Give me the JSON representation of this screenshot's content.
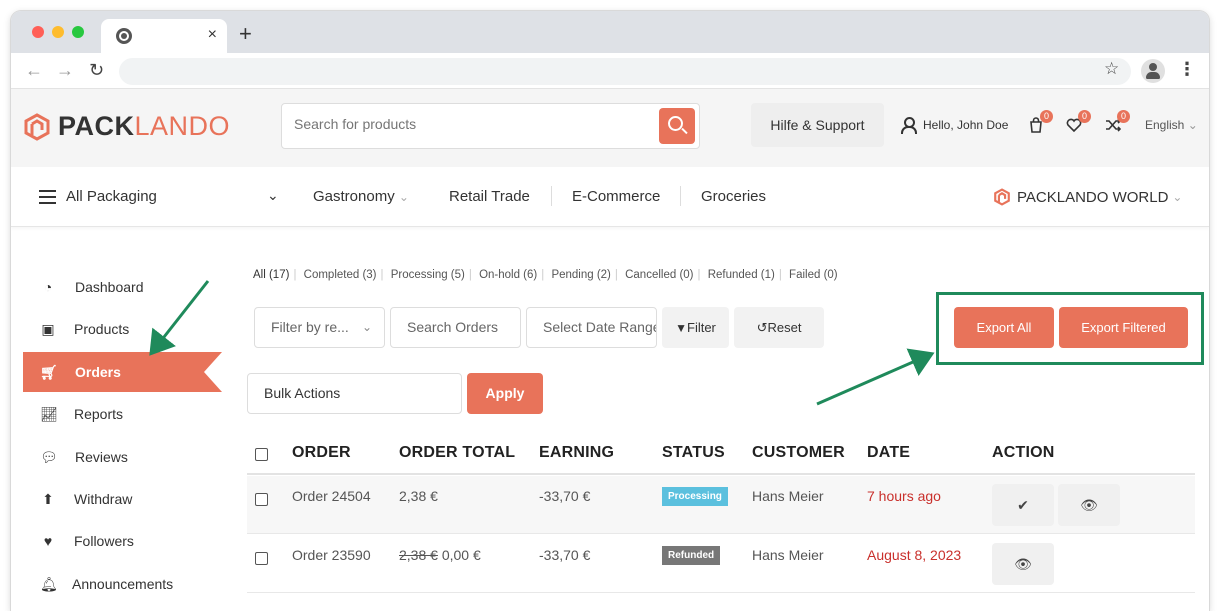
{
  "browser": {
    "tab_close": "×",
    "new_tab": "+",
    "back": "←",
    "forward": "→",
    "reload": "↻",
    "star": "☆",
    "menu": "⋮"
  },
  "header": {
    "logo_pack": "PACK",
    "logo_lando": "LANDO",
    "search_placeholder": "Search for products",
    "support_label": "Hilfe & Support",
    "hello_label": "Hello, John Doe",
    "cart_count": "0",
    "wishlist_count": "0",
    "compare_count": "0",
    "language": "English",
    "language_chevron": "⌄"
  },
  "catnav": {
    "all_label": "All Packaging",
    "chevron": "⌄",
    "items": [
      {
        "label": "Gastronomy",
        "chevron": "⌄"
      },
      {
        "label": "Retail Trade"
      },
      {
        "label": "E-Commerce"
      },
      {
        "label": "Groceries"
      }
    ],
    "world_label": "PACKLANDO WORLD",
    "world_chevron": "⌄"
  },
  "sidebar": {
    "items": [
      {
        "label": "Dashboard",
        "icon": "gauge-icon"
      },
      {
        "label": "Products",
        "icon": "briefcase-icon"
      },
      {
        "label": "Orders",
        "icon": "cart-icon",
        "active": true
      },
      {
        "label": "Reports",
        "icon": "chart-icon"
      },
      {
        "label": "Reviews",
        "icon": "comments-icon"
      },
      {
        "label": "Withdraw",
        "icon": "upload-icon"
      },
      {
        "label": "Followers",
        "icon": "heart-icon"
      },
      {
        "label": "Announcements",
        "icon": "bell-icon"
      }
    ]
  },
  "filters": {
    "statuses": [
      "All (17)",
      "Completed (3)",
      "Processing (5)",
      "On-hold (6)",
      "Pending (2)",
      "Cancelled (0)",
      "Refunded (1)",
      "Failed (0)"
    ],
    "filter_by_registered": "Filter by re...",
    "search_orders": "Search Orders",
    "select_date_range": "Select Date Range",
    "filter_label": "Filter",
    "reset_label": "Reset",
    "export_all": "Export All",
    "export_filtered": "Export Filtered",
    "bulk_actions": "Bulk Actions",
    "apply": "Apply"
  },
  "table": {
    "headers": [
      "ORDER",
      "ORDER TOTAL",
      "EARNING",
      "STATUS",
      "CUSTOMER",
      "DATE",
      "ACTION"
    ],
    "rows": [
      {
        "order": "Order 24504",
        "total": "2,38 €",
        "total_old": "",
        "earning": "-33,70 €",
        "status": "Processing",
        "customer": "Hans Meier",
        "date": "7 hours ago"
      },
      {
        "order": "Order 23590",
        "total": "0,00 €",
        "total_old": "2,38 €",
        "earning": "-33,70 €",
        "status": "Refunded",
        "customer": "Hans Meier",
        "date": "August 8, 2023"
      }
    ]
  },
  "colors": {
    "accent": "#e8735a",
    "annotation": "#1f8a5b",
    "processing": "#5bc0de",
    "refunded": "#777777",
    "date": "#c9302c"
  }
}
